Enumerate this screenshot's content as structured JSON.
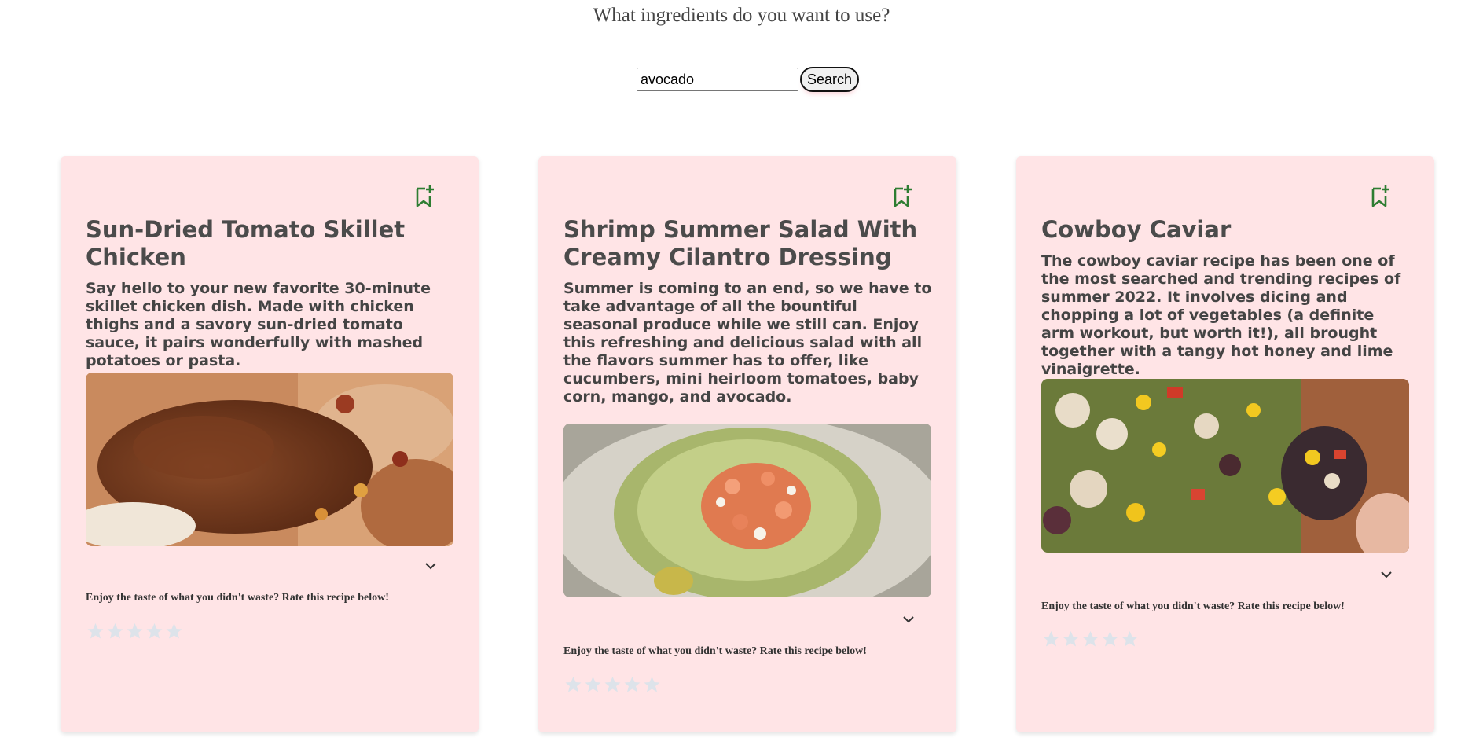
{
  "search": {
    "prompt": "What ingredients do you want to use?",
    "value": "avocado",
    "button_label": "Search"
  },
  "accent_colors": {
    "card_background": "#ffe4e6",
    "bookmark_icon": "#2e7d32",
    "star_empty": "#dde3ea"
  },
  "recipes": [
    {
      "title": "Sun-Dried Tomato Skillet Chicken",
      "description": "Say hello to your new favorite 30-minute skillet chicken dish. Made with chicken thighs and a savory sun-dried tomato sauce, it pairs wonderfully with mashed potatoes or pasta.",
      "rate_prompt": "Enjoy the taste of what you didn't waste? Rate this recipe below!",
      "rating": 0,
      "max_rating": 5,
      "icons": [
        "bookmark-plus-icon",
        "chevron-down-icon",
        "star-icon"
      ]
    },
    {
      "title": "Shrimp Summer Salad With Creamy Cilantro Dressing",
      "description": "Summer is coming to an end, so we have to take advantage of all the bountiful seasonal produce while we still can. Enjoy this refreshing and delicious salad with all the flavors summer has to offer, like cucumbers, mini heirloom tomatoes, baby corn, mango, and avocado.",
      "rate_prompt": "Enjoy the taste of what you didn't waste? Rate this recipe below!",
      "rating": 0,
      "max_rating": 5,
      "icons": [
        "bookmark-plus-icon",
        "chevron-down-icon",
        "star-icon"
      ]
    },
    {
      "title": "Cowboy Caviar",
      "description": "The cowboy caviar recipe has been one of the most searched and trending recipes of summer 2022. It involves dicing and chopping a lot of vegetables (a definite arm workout, but worth it!), all brought together with a tangy hot honey and lime vinaigrette.",
      "rate_prompt": "Enjoy the taste of what you didn't waste? Rate this recipe below!",
      "rating": 0,
      "max_rating": 5,
      "icons": [
        "bookmark-plus-icon",
        "chevron-down-icon",
        "star-icon"
      ]
    }
  ]
}
